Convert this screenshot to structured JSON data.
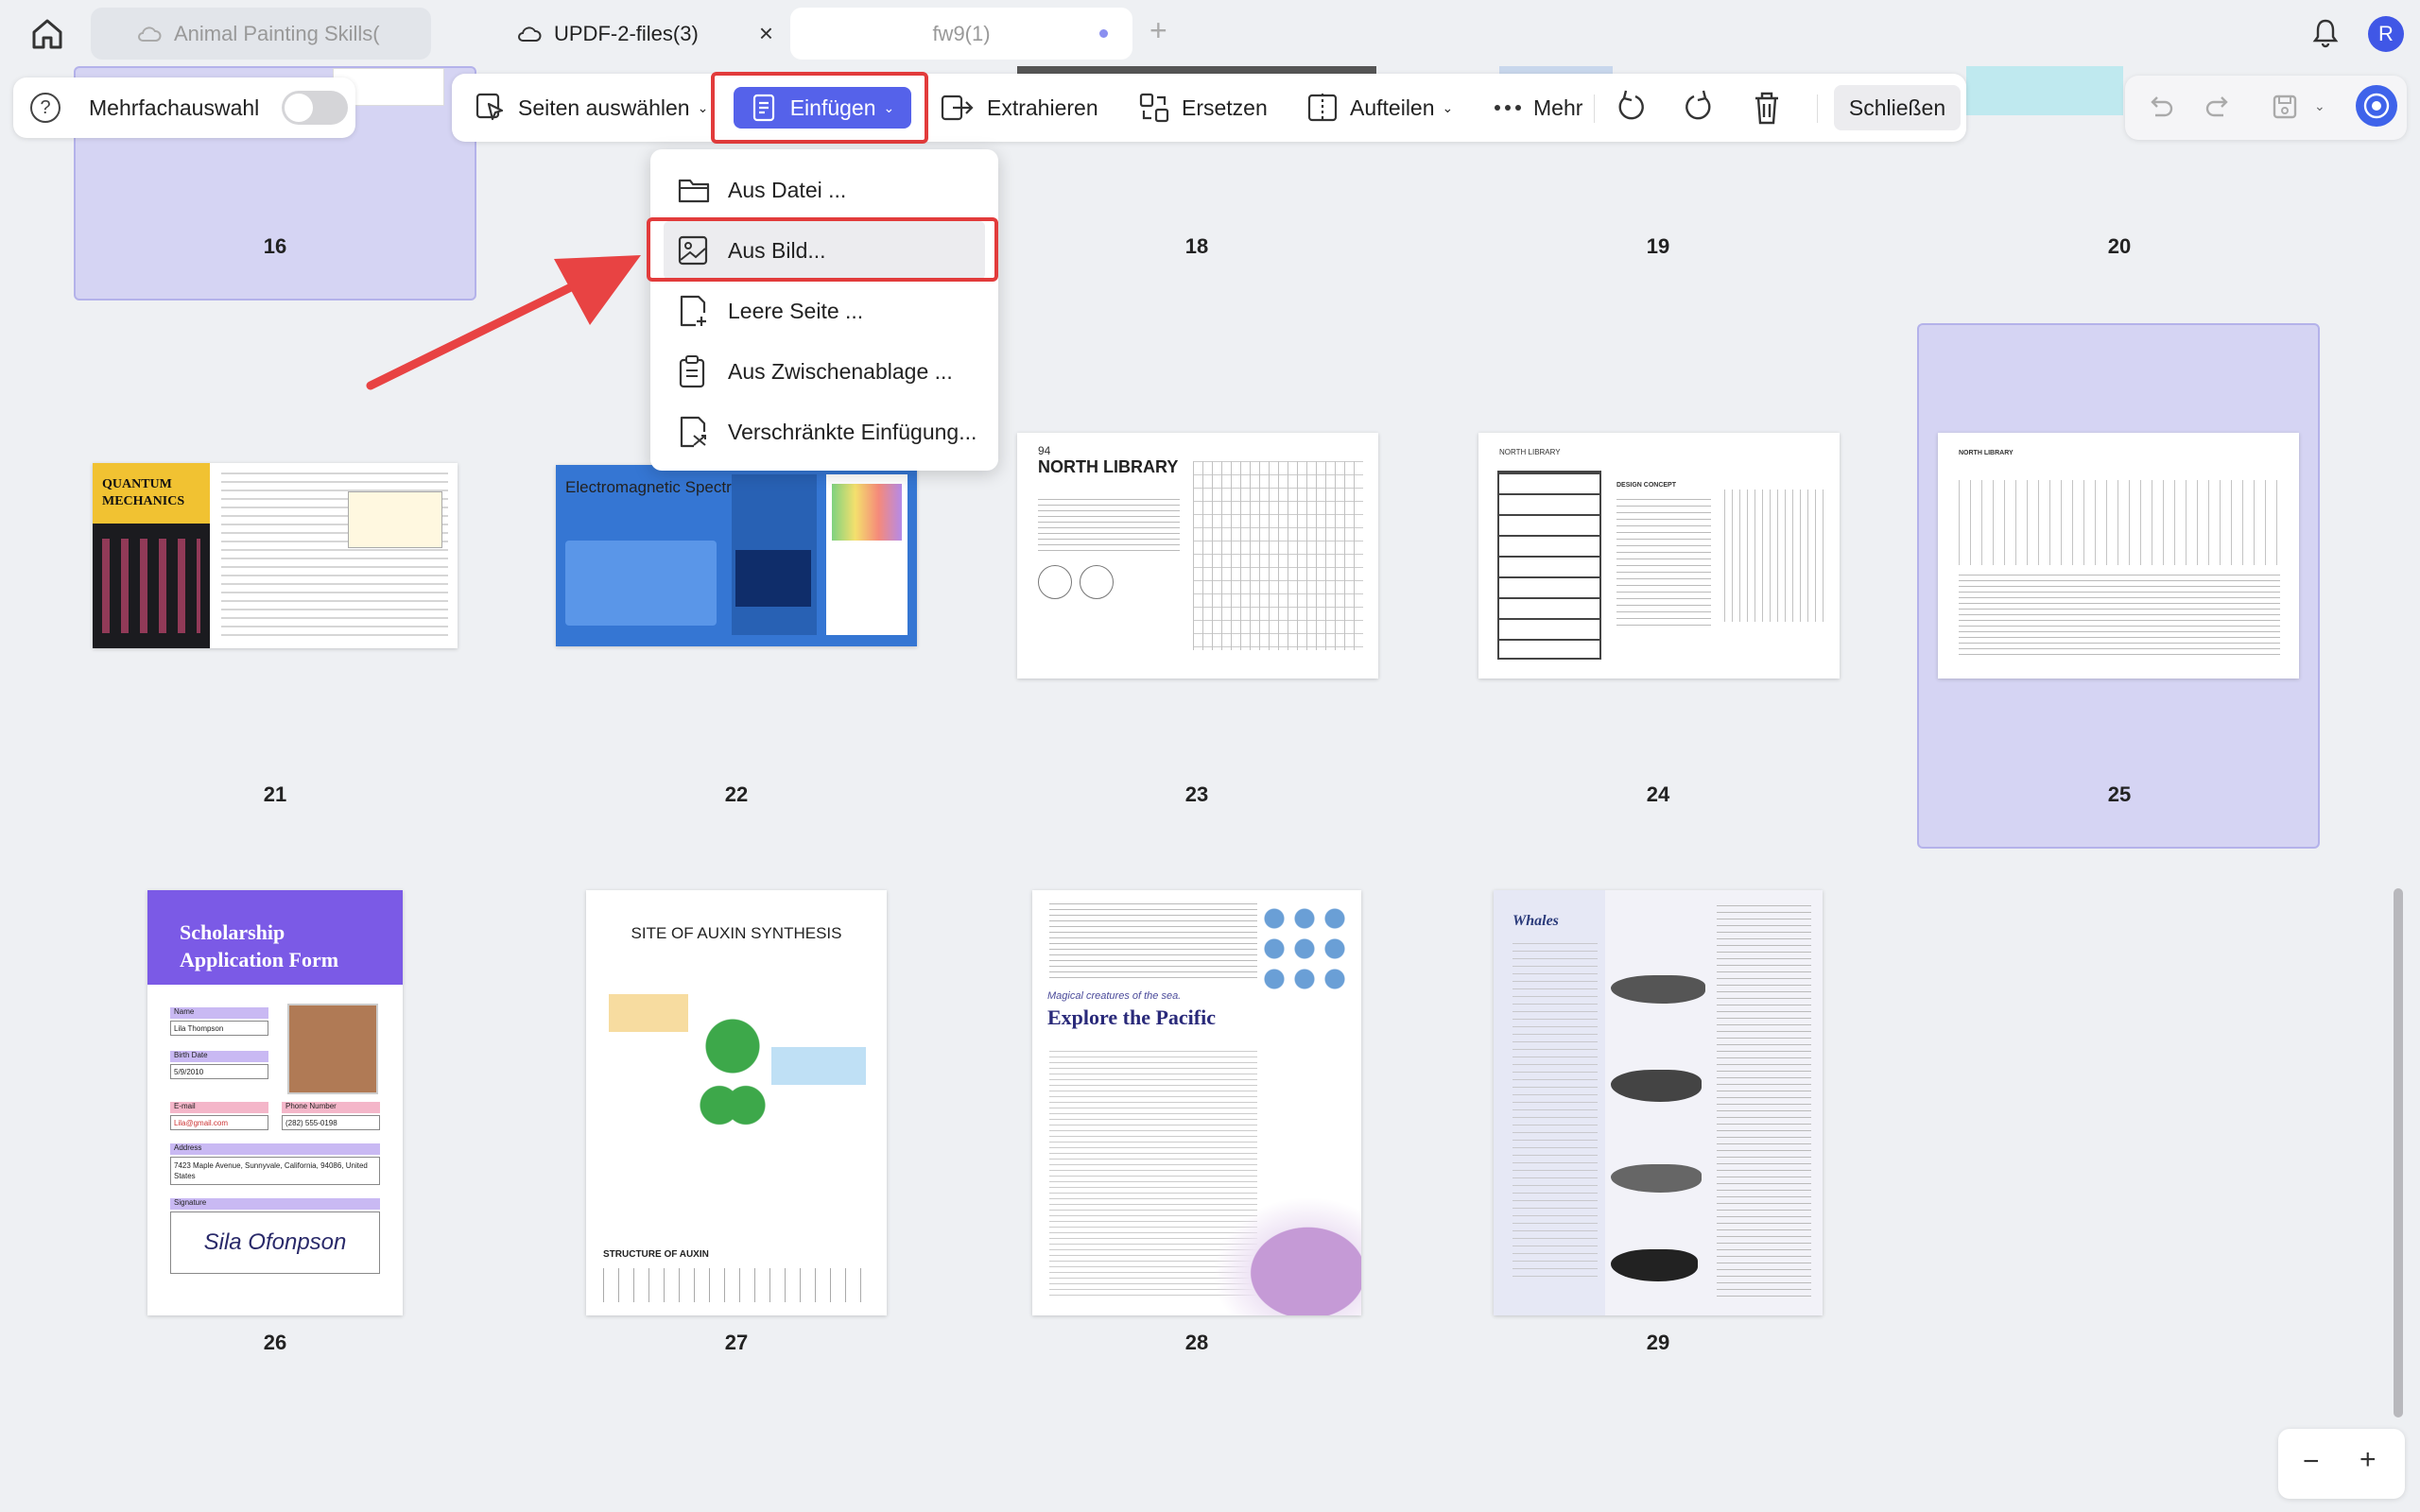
{
  "tabs": [
    {
      "label": "Animal Painting Skills(",
      "state": "inactive"
    },
    {
      "label": "UPDF-2-files(3)",
      "state": "active"
    },
    {
      "label": "fw9(1)",
      "state": "inactive"
    }
  ],
  "user": {
    "initial": "R"
  },
  "multi_select": {
    "label": "Mehrfachauswahl",
    "on": false
  },
  "toolbar": {
    "select_pages": "Seiten auswählen",
    "insert": "Einfügen",
    "extract": "Extrahieren",
    "replace": "Ersetzen",
    "split": "Aufteilen",
    "more": "Mehr",
    "close": "Schließen"
  },
  "insert_menu": [
    {
      "label": "Aus Datei ...",
      "icon": "folder-icon"
    },
    {
      "label": "Aus Bild...",
      "icon": "image-icon"
    },
    {
      "label": "Leere Seite ...",
      "icon": "blank-page-icon"
    },
    {
      "label": "Aus Zwischenablage ...",
      "icon": "clipboard-icon"
    },
    {
      "label": "Verschränkte Einfügung...",
      "icon": "interleave-icon"
    }
  ],
  "pages": {
    "row1": [
      "16",
      "18",
      "19",
      "20"
    ],
    "row2": [
      "21",
      "22",
      "23",
      "24",
      "25"
    ],
    "row3": [
      "26",
      "27",
      "28",
      "29"
    ]
  },
  "page_text": {
    "p21_title": "QUANTUM MECHANICS",
    "p22_title": "Electromagnetic Spectrum",
    "p23_title": "NORTH LIBRARY",
    "p23_num": "94",
    "p24_title": "NORTH LIBRARY",
    "p24_sub": "DESIGN CONCEPT",
    "p25_title": "NORTH LIBRARY",
    "p26_title": "Scholarship Application Form",
    "p26_name_label": "Name",
    "p26_name": "Lila Thompson",
    "p26_birth_label": "Birth Date",
    "p26_birth": "5/9/2010",
    "p26_email_label": "E-mail",
    "p26_email": "Lila@gmail.com",
    "p26_phone_label": "Phone Number",
    "p26_phone": "(282) 555-0198",
    "p26_address_label": "Address",
    "p26_address": "7423 Maple Avenue, Sunnyvale, California, 94086, United States",
    "p26_sig_label": "Signature",
    "p26_sig": "Sila Ofonpson",
    "p27_title": "SITE OF AUXIN SYNTHESIS",
    "p27_sub": "STRUCTURE OF AUXIN",
    "p28_kicker": "Magical creatures of the sea.",
    "p28_title": "Explore the Pacific",
    "p29_title": "Whales"
  },
  "colors": {
    "accent": "#5562ea",
    "selection": "#d5d4f3",
    "highlight_red": "#e23b3b"
  }
}
